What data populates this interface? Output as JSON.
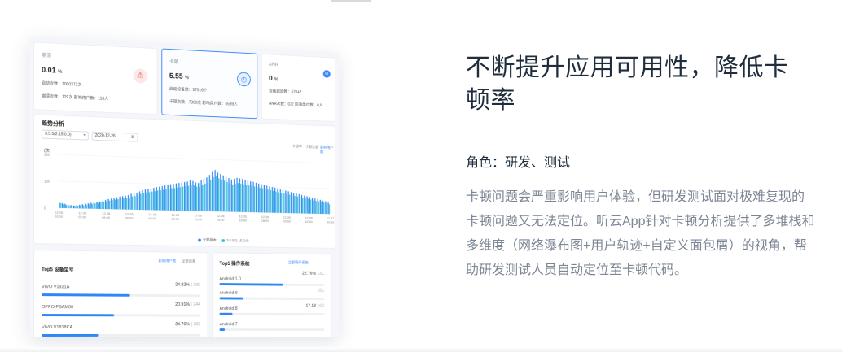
{
  "copy": {
    "headline": "不断提升应用可用性，降低卡顿率",
    "role": "角色：研发、测试",
    "description": "卡顿问题会严重影响用户体验，但研发测试面对极难复现的卡顿问题又无法定位。听云App针对卡顿分析提供了多堆栈和多维度（网络瀑布图+用户轨迹+自定义面包屑）的视角，帮助研发测试人员自动定位至卡顿代码。"
  },
  "dashboard": {
    "cards": [
      {
        "title": "崩溃",
        "value": "0.01",
        "unit": "%",
        "line1": "启动次数：1000372次",
        "line2": "崩溃次数：129次   影响用户数：113人",
        "icon": "warning-icon"
      },
      {
        "title": "卡顿",
        "value": "5.55",
        "unit": "%",
        "line1": "启动设备数：57016个",
        "line2": "卡顿次数：7300次   影响用户数：6589人",
        "icon": "clock-icon"
      },
      {
        "title": "ANR",
        "value": "0",
        "unit": "%",
        "line1": "设备启动数：57047",
        "line2": "ANR次数：0次   影响用户数：0人",
        "icon": "block-icon"
      }
    ],
    "trend": {
      "title": "趋势分析",
      "version_select": "3.5.5(2.15.0.0)",
      "date_select": "2020-12-26",
      "segments": [
        "卡顿率",
        "卡顿次数",
        "影响用户数"
      ],
      "active_segment": 2,
      "legend": [
        "全部版本",
        "3.5.5(2.15.0.0)"
      ]
    },
    "panel_device": {
      "title": "Top5 设备型号",
      "link1": "影响用户数",
      "link2": "全部设备",
      "rows": [
        {
          "label": "VIVO V1921A",
          "percent": "24.82%",
          "count": "290",
          "fill": 0.55
        },
        {
          "label": "OPPO PBAM00",
          "percent": "20.91%",
          "count": "244",
          "fill": 0.45
        },
        {
          "label": "VIVO V1818CA",
          "percent": "34.76%",
          "count": "182",
          "fill": 0.35
        }
      ]
    },
    "panel_os": {
      "title": "Top5 操作系统",
      "link": "全部操作系统",
      "rows": [
        {
          "label": "Android 1.0",
          "percent": "22.76%",
          "count": "13C",
          "fill": 0.6
        },
        {
          "label": "Android 9",
          "percent": "",
          "count": "15C",
          "fill": 0.22
        },
        {
          "label": "Android 8",
          "percent": "17.13",
          "count": "16C",
          "fill": 0.12
        },
        {
          "label": "Android 7",
          "percent": "",
          "count": "",
          "fill": 0.05
        }
      ]
    }
  },
  "chart_data": {
    "type": "bar",
    "ylabel": "(次)",
    "ylim": [
      0,
      200
    ],
    "yticks": [
      "200",
      "100",
      "0"
    ],
    "xticks": [
      "12-26 00:00",
      "12-26 02:00",
      "12-26 04:00",
      "12-26 06:00",
      "12-26 08:00",
      "12-26 10:00",
      "12-26 12:00",
      "12-26 14:00",
      "12-26 16:00",
      "12-26 18:00",
      "12-26 20:00",
      "12-26 22:00",
      "12-27 00:00"
    ],
    "series": [
      {
        "name": "全部版本",
        "color": "#2f86f6",
        "values": [
          22,
          18,
          16,
          14,
          12,
          10,
          12,
          14,
          16,
          18,
          20,
          22,
          24,
          26,
          28,
          30,
          34,
          38,
          40,
          42,
          45,
          48,
          50,
          52,
          55,
          60,
          62,
          65,
          70,
          75,
          78,
          80,
          82,
          85,
          88,
          90,
          92,
          95,
          98,
          100,
          102,
          104,
          106,
          108,
          110,
          112,
          118,
          115,
          110,
          108,
          120,
          125,
          130,
          140,
          155,
          160,
          150,
          145,
          140,
          135,
          130,
          125,
          128,
          132,
          130,
          128,
          125,
          122,
          120,
          118,
          115,
          112,
          110,
          108,
          105,
          102,
          100,
          98,
          95,
          92,
          90,
          88,
          85,
          82,
          80,
          78,
          75,
          72,
          70,
          68,
          65,
          62,
          60,
          58,
          55,
          52,
          50,
          45
        ]
      },
      {
        "name": "3.5.5(2.15.0.0)",
        "color": "#34c3d9",
        "values": [
          18,
          14,
          12,
          10,
          9,
          8,
          9,
          10,
          12,
          14,
          16,
          18,
          20,
          22,
          24,
          26,
          28,
          32,
          34,
          36,
          38,
          40,
          42,
          44,
          46,
          50,
          52,
          55,
          60,
          64,
          66,
          68,
          70,
          72,
          75,
          76,
          78,
          80,
          82,
          85,
          86,
          88,
          90,
          92,
          94,
          96,
          100,
          98,
          94,
          92,
          102,
          106,
          110,
          120,
          132,
          136,
          128,
          124,
          120,
          115,
          110,
          106,
          108,
          112,
          110,
          108,
          106,
          104,
          102,
          100,
          98,
          96,
          94,
          92,
          90,
          88,
          85,
          83,
          80,
          78,
          76,
          74,
          72,
          70,
          68,
          66,
          64,
          62,
          60,
          58,
          55,
          52,
          50,
          49,
          47,
          44,
          42,
          38
        ]
      }
    ]
  },
  "colors": {
    "accent": "#2f86f6",
    "secondary": "#34c3d9",
    "headline": "#1f2d3d",
    "body_text": "#7d8694",
    "warning": "#e04b4b"
  }
}
